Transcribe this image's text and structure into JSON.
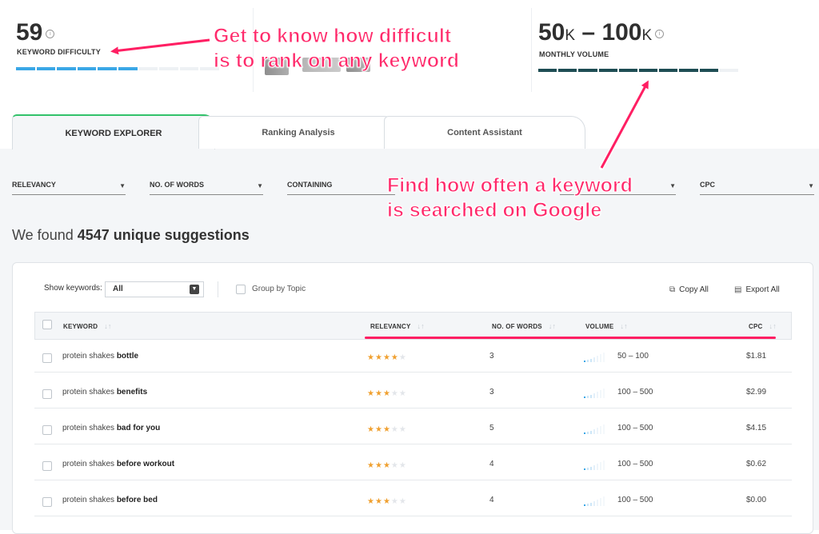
{
  "metrics": {
    "difficulty_value": "59",
    "difficulty_label": "KEYWORD DIFFICULTY",
    "volume_low": "50",
    "volume_low_unit": "K",
    "volume_dash": "–",
    "volume_high": "100",
    "volume_high_unit": "K",
    "volume_label": "MONTHLY VOLUME",
    "info_symbol": "i",
    "difficulty_bar_fraction": 0.59,
    "volume_bar_fraction": 0.88,
    "difficulty_color": "#3aa7e6",
    "volume_color": "#1e4d54"
  },
  "annotations": {
    "difficulty_line1": "Get to know how difficult",
    "difficulty_line2": "is to rank on any keyword",
    "volume_line1": "Find how often a keyword",
    "volume_line2": "is searched on Google",
    "color": "#ff2a6b"
  },
  "tabs": [
    {
      "label": "KEYWORD EXPLORER",
      "active": true
    },
    {
      "label": "Ranking Analysis",
      "active": false
    },
    {
      "label": "Content Assistant",
      "active": false
    }
  ],
  "filters": [
    {
      "label": "RELEVANCY"
    },
    {
      "label": "NO. OF WORDS"
    },
    {
      "label": "CONTAINING"
    },
    {
      "label": "CPC"
    }
  ],
  "results": {
    "prefix": "We found ",
    "count_text": "4547 unique suggestions"
  },
  "toolbar": {
    "show_keywords_label": "Show keywords:",
    "show_keywords_value": "All",
    "group_by_topic": "Group by Topic",
    "copy_all": "Copy All",
    "export_all": "Export All"
  },
  "table": {
    "headers": {
      "keyword": "KEYWORD",
      "relevancy": "RELEVANCY",
      "words": "NO. OF WORDS",
      "volume": "VOLUME",
      "cpc": "CPC"
    },
    "sort_symbol": "↓↑",
    "rows": [
      {
        "base": "protein shakes ",
        "bold": "bottle",
        "stars": 4,
        "words": "3",
        "volume": "50 – 100",
        "cpc": "$1.81"
      },
      {
        "base": "protein shakes ",
        "bold": "benefits",
        "stars": 3,
        "words": "3",
        "volume": "100 – 500",
        "cpc": "$2.99"
      },
      {
        "base": "protein shakes ",
        "bold": "bad for you",
        "stars": 3,
        "words": "5",
        "volume": "100 – 500",
        "cpc": "$4.15"
      },
      {
        "base": "protein shakes ",
        "bold": "before workout",
        "stars": 3,
        "words": "4",
        "volume": "100 – 500",
        "cpc": "$0.62"
      },
      {
        "base": "protein shakes ",
        "bold": "before bed",
        "stars": 3,
        "words": "4",
        "volume": "100 – 500",
        "cpc": "$0.00"
      }
    ]
  }
}
